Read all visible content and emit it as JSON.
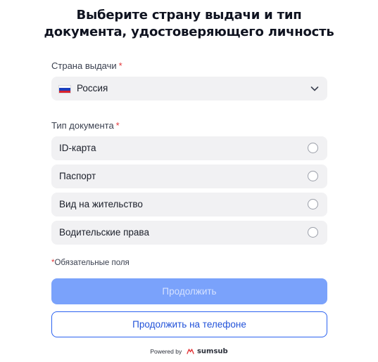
{
  "title": {
    "line1": "Выберите страну выдачи и тип",
    "line2": "документа, удостоверяющего личность"
  },
  "country": {
    "label": "Страна выдачи",
    "required_mark": "*",
    "selected_value": "Россия",
    "flag_icon": "russia-flag-icon",
    "dropdown_icon": "chevron-down-icon"
  },
  "document_type": {
    "label": "Тип документа",
    "required_mark": "*",
    "options": [
      {
        "label": "ID-карта",
        "selected": false
      },
      {
        "label": "Паспорт",
        "selected": false
      },
      {
        "label": "Вид на жительство",
        "selected": false
      },
      {
        "label": "Водительские права",
        "selected": false
      }
    ]
  },
  "required_note": {
    "mark": "*",
    "text": "Обязательные поля"
  },
  "buttons": {
    "continue": "Продолжить",
    "continue_on_phone": "Продолжить на телефоне"
  },
  "footer": {
    "powered_by": "Powered by",
    "brand": "sumsub",
    "logo_icon": "sumsub-logo-icon"
  },
  "colors": {
    "primary_disabled": "#7aa2fb",
    "primary": "#2b62f0",
    "required": "#e3373a",
    "field_bg": "#f1f1f3"
  }
}
